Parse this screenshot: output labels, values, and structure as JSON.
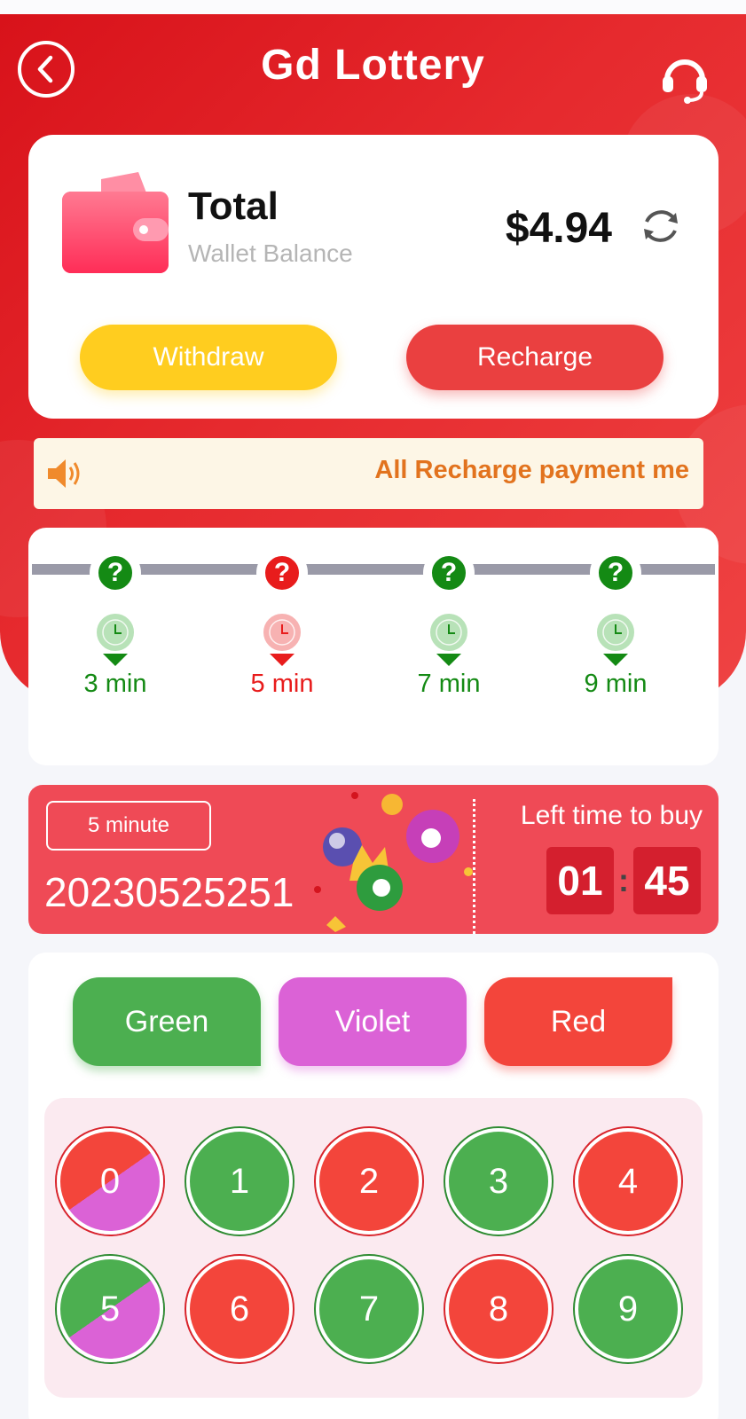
{
  "header": {
    "title": "Gd Lottery"
  },
  "wallet": {
    "total_label": "Total",
    "sub_label": "Wallet Balance",
    "balance": "$4.94",
    "withdraw_label": "Withdraw",
    "recharge_label": "Recharge"
  },
  "notice": {
    "text": "All Recharge payment me"
  },
  "game_tabs": [
    {
      "label": "3 min",
      "active": false
    },
    {
      "label": "5 min",
      "active": true
    },
    {
      "label": "7 min",
      "active": false
    },
    {
      "label": "9 min",
      "active": false
    }
  ],
  "round": {
    "mode": "5 minute",
    "period": "20230525251",
    "left_time_label": "Left time to buy",
    "minutes": "01",
    "seconds": "45"
  },
  "bet": {
    "colors": [
      "Green",
      "Violet",
      "Red"
    ],
    "numbers": [
      {
        "n": "0",
        "color": "red-violet"
      },
      {
        "n": "1",
        "color": "green"
      },
      {
        "n": "2",
        "color": "red"
      },
      {
        "n": "3",
        "color": "green"
      },
      {
        "n": "4",
        "color": "red"
      },
      {
        "n": "5",
        "color": "green-violet"
      },
      {
        "n": "6",
        "color": "red"
      },
      {
        "n": "7",
        "color": "green"
      },
      {
        "n": "8",
        "color": "red"
      },
      {
        "n": "9",
        "color": "green"
      }
    ]
  },
  "theme": {
    "primary_red": "#e62a2e",
    "green": "#4caf50",
    "violet": "#db62d6",
    "red": "#f3453b",
    "yellow": "#ffcd1f",
    "notice_text": "#e2731e"
  }
}
